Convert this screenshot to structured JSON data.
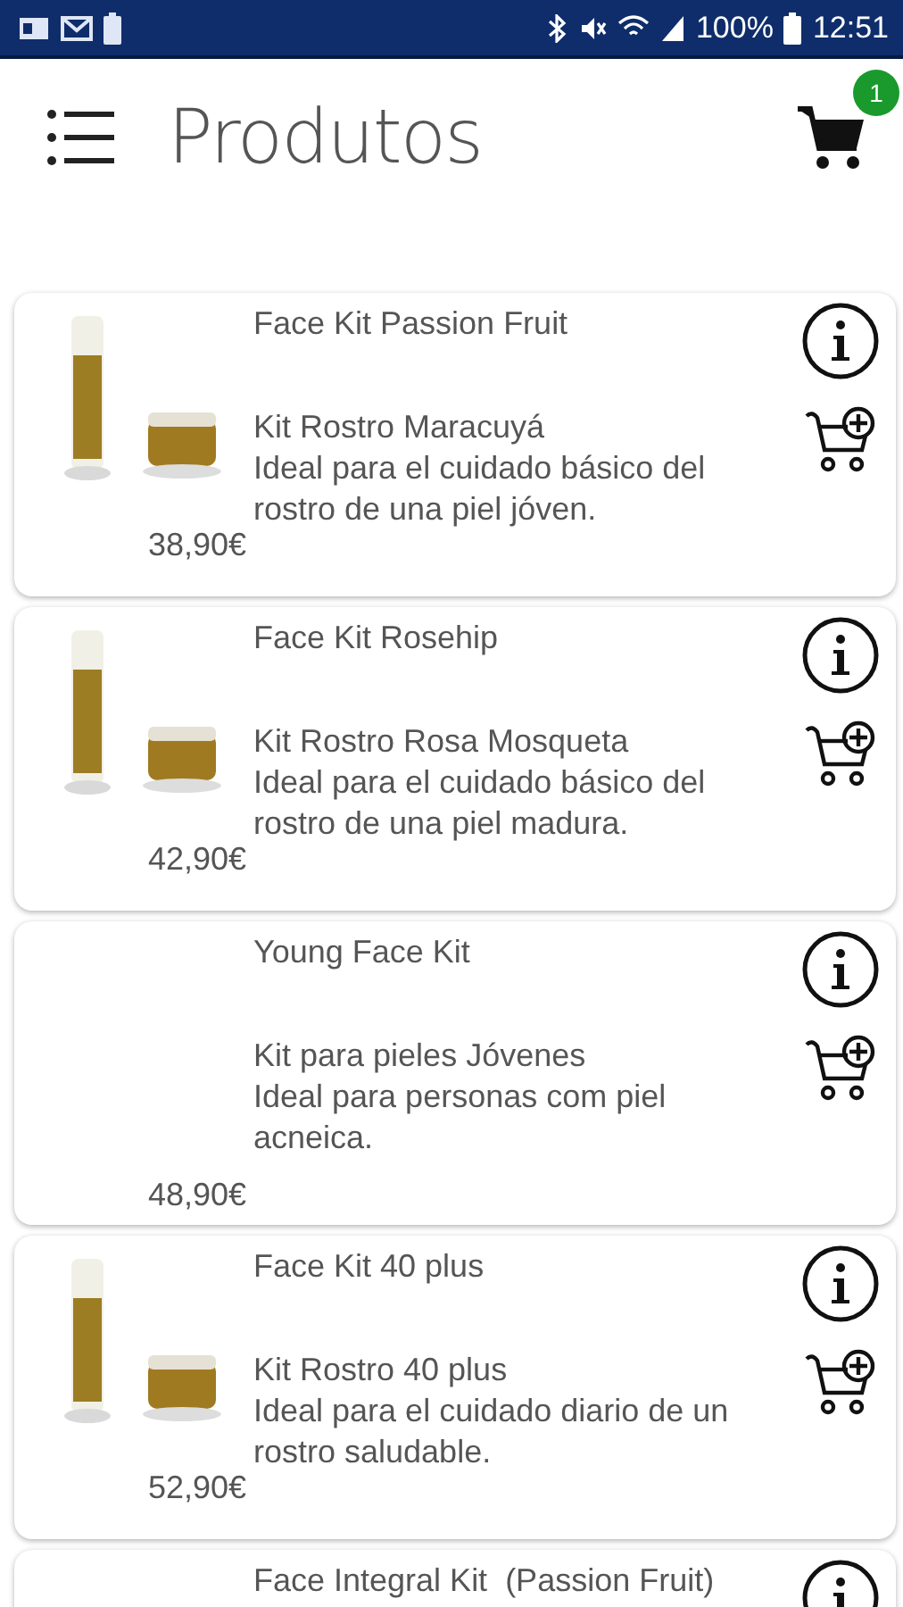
{
  "status_bar": {
    "battery": "100%",
    "time": "12:51"
  },
  "header": {
    "title": "Produtos",
    "cart_count": "1"
  },
  "products": [
    {
      "name": "Face Kit Passion Fruit",
      "subtitle": "Kit Rostro Maracuyá",
      "description": "Ideal para el cuidado básico del rostro de una piel jóven.",
      "price": "38,90€"
    },
    {
      "name": "Face Kit Rosehip",
      "subtitle": "Kit Rostro Rosa Mosqueta",
      "description": "Ideal para el cuidado básico del rostro de una piel madura.",
      "price": "42,90€"
    },
    {
      "name": "Young Face Kit",
      "subtitle": "Kit para pieles Jóvenes",
      "description": "Ideal para personas com piel acneica.",
      "price": "48,90€"
    },
    {
      "name": "Face Kit 40 plus",
      "subtitle": "Kit Rostro 40 plus",
      "description": "Ideal para el cuidado diario de un rostro saludable.",
      "price": "52,90€"
    },
    {
      "name": "Face Integral Kit  (Passion Fruit)"
    }
  ]
}
